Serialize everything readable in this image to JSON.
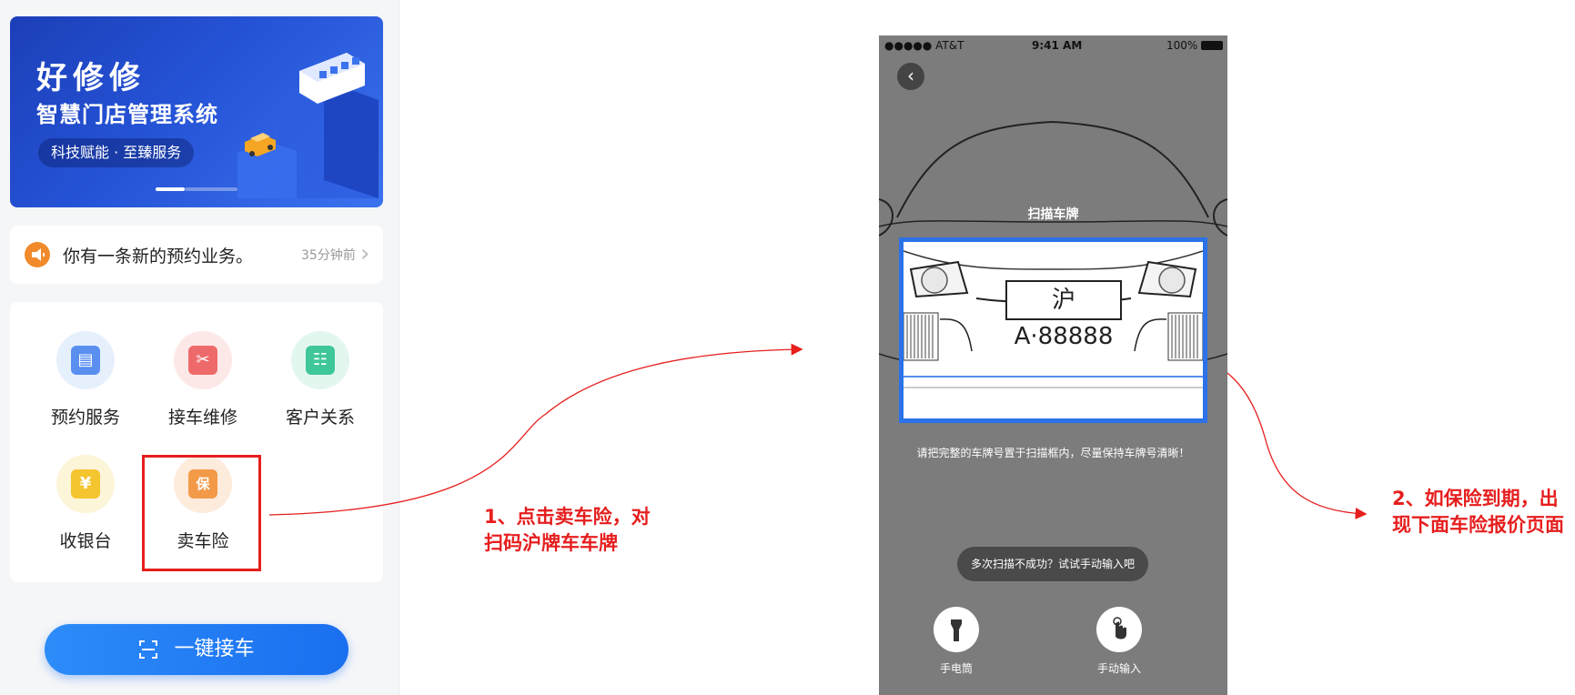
{
  "home": {
    "banner": {
      "logo": "好修修",
      "title": "智慧门店管理系统",
      "slogan": "科技赋能 · 至臻服务"
    },
    "notice": {
      "text": "你有一条新的预约业务。",
      "time": "35分钟前"
    },
    "features": [
      {
        "label": "预约服务",
        "icon": "calendar-icon",
        "color": "#5a8ff0",
        "bg": "#e6f0fd"
      },
      {
        "label": "接车维修",
        "icon": "tools-icon",
        "color": "#ee6a6a",
        "bg": "#fde8e8"
      },
      {
        "label": "客户关系",
        "icon": "contacts-icon",
        "color": "#3fc79a",
        "bg": "#e3f7ef"
      },
      {
        "label": "收银台",
        "icon": "yuan-icon",
        "color": "#f5c530",
        "bg": "#fdf5d8"
      },
      {
        "label": "卖车险",
        "icon": "insurance-shield-icon",
        "color": "#f39a48",
        "bg": "#fdebdc"
      }
    ],
    "feature_glyphs": [
      "▤",
      "✂",
      "☷",
      "¥",
      "保"
    ],
    "cta": {
      "label": "一键接车",
      "icon": "scan-icon"
    }
  },
  "annotations": {
    "step1": "1、点击卖车险，对扫码沪牌车车牌",
    "step2": "2、如保险到期，出现下面车险报价页面",
    "highlight_color": "#e61e1e"
  },
  "scanner": {
    "status": {
      "carrier": "●●●●● AT&T",
      "time": "9:41 AM",
      "battery": "100%"
    },
    "title": "扫描车牌",
    "plate": "沪A·88888",
    "hint": "请把完整的车牌号置于扫描框内，尽量保持车牌号清晰！",
    "manual_prompt": "多次扫描不成功？试试手动输入吧",
    "tools": [
      {
        "label": "手电筒",
        "icon": "flashlight-icon"
      },
      {
        "label": "手动输入",
        "icon": "hand-tap-icon"
      }
    ],
    "frame_color": "#2b72e8"
  }
}
